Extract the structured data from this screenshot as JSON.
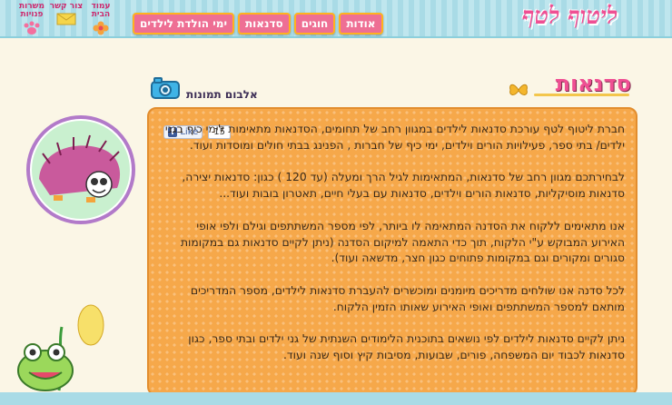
{
  "header": {
    "logo": "ליטוף לטף",
    "nav": [
      {
        "label": "אודות"
      },
      {
        "label": "חוגים"
      },
      {
        "label": "סדנאות"
      },
      {
        "label": "ימי הולדת לילדים"
      }
    ],
    "utility": {
      "home": "עמוד הבית",
      "contact": "צור קשר",
      "messages": "משרות פנויות"
    }
  },
  "page": {
    "title": "סדנאות",
    "album_link": "אלבום תמונות",
    "facebook": {
      "like_label": "Like",
      "count": "15"
    },
    "paragraphs": [
      "חברת ליטוף לטף עורכת סדנאות לילדים במגוון רחב של תחומים, הסדנאות מתאימות לימי כיף בגני ילדים/ בתי ספר, פעילויות הורים וילדים, ימי כיף של חברות , הפנינג בבתי חולים ומוסדות ועוד.",
      "לבחירתכם מגוון רחב של סדנאות, המתאימות לגיל הרך ומעלה (עד 120 ) כגון: סדנאות יצירה, סדנאות מוסיקליות, סדנאות הורים וילדים, סדנאות עם בעלי חיים, תאטרון בובות ועוד...",
      "אנו מתאימים ללקוח את הסדנה המתאימה לו ביותר, לפי מספר המשתתפים וגילם ולפי אופי האירוע המבוקש ע\"י הלקוח, תוך כדי התאמה למיקום הסדנה (ניתן לקיים סדנאות גם במקומות סגורים ומקורים וגם במקומות פתוחים כגון חצר, מדשאה ועוד).",
      "לכל סדנה אנו שולחים מדריכים מיומנים ומוכשרים להעברת סדנאות לילדים, מספר המדריכים מותאם למספר המשתתפים ואופי האירוע שאותו הזמין הלקוח.",
      "ניתן לקיים סדנאות לילדים לפי נושאים בתוכנית הלימודים השנתית של גני ילדים ובתי ספר, כגון סדנאות לכבוד יום המשפחה, פורים, שבועות, מסיבות קיץ וסוף שנה ועוד."
    ]
  },
  "colors": {
    "accent_pink": "#ef4f93",
    "panel_orange": "#f6a84a",
    "header_blue": "#a9dbe6"
  }
}
